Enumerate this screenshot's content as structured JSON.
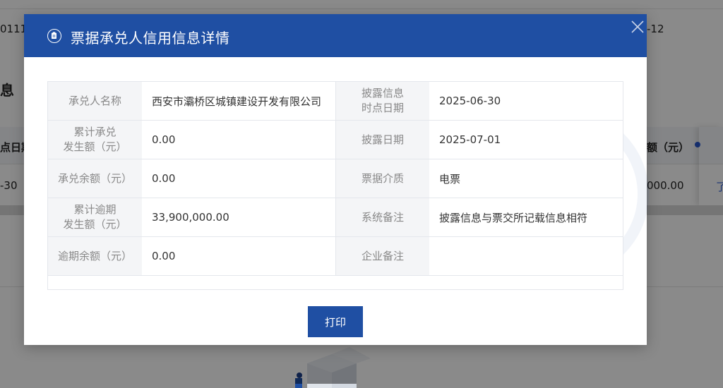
{
  "background": {
    "top_row_left": "01112",
    "top_row_right": "-12",
    "section_heading": "息",
    "table_header_left": "点日期",
    "table_header_right": "额（元）",
    "table_row_left": "-30",
    "table_row_amount": "000.00",
    "table_row_link": "了"
  },
  "modal": {
    "title": "票据承兑人信用信息详情",
    "close_label": "×",
    "rows": [
      {
        "label1": "承兑人名称",
        "value1": "西安市灞桥区城镇建设开发有限公司",
        "label2": "披露信息\n时点日期",
        "value2": "2025-06-30"
      },
      {
        "label1": "累计承兑\n发生额（元）",
        "value1": "0.00",
        "label2": "披露日期",
        "value2": "2025-07-01"
      },
      {
        "label1": "承兑余额（元）",
        "value1": "0.00",
        "label2": "票据介质",
        "value2": "电票"
      },
      {
        "label1": "累计逾期\n发生额（元）",
        "value1": "33,900,000.00",
        "label2": "系统备注",
        "value2": "披露信息与票交所记载信息相符"
      },
      {
        "label1": "逾期余额（元）",
        "value1": "0.00",
        "label2": "企业备注",
        "value2": ""
      }
    ],
    "print_label": "打印"
  },
  "colors": {
    "header_bg": "#1f4fa3",
    "label_bg": "#f4f5f7",
    "overlay": "rgba(0,0,0,0.46)"
  },
  "icons": {
    "title_icon": "clipboard-icon",
    "close_icon": "close-icon"
  }
}
